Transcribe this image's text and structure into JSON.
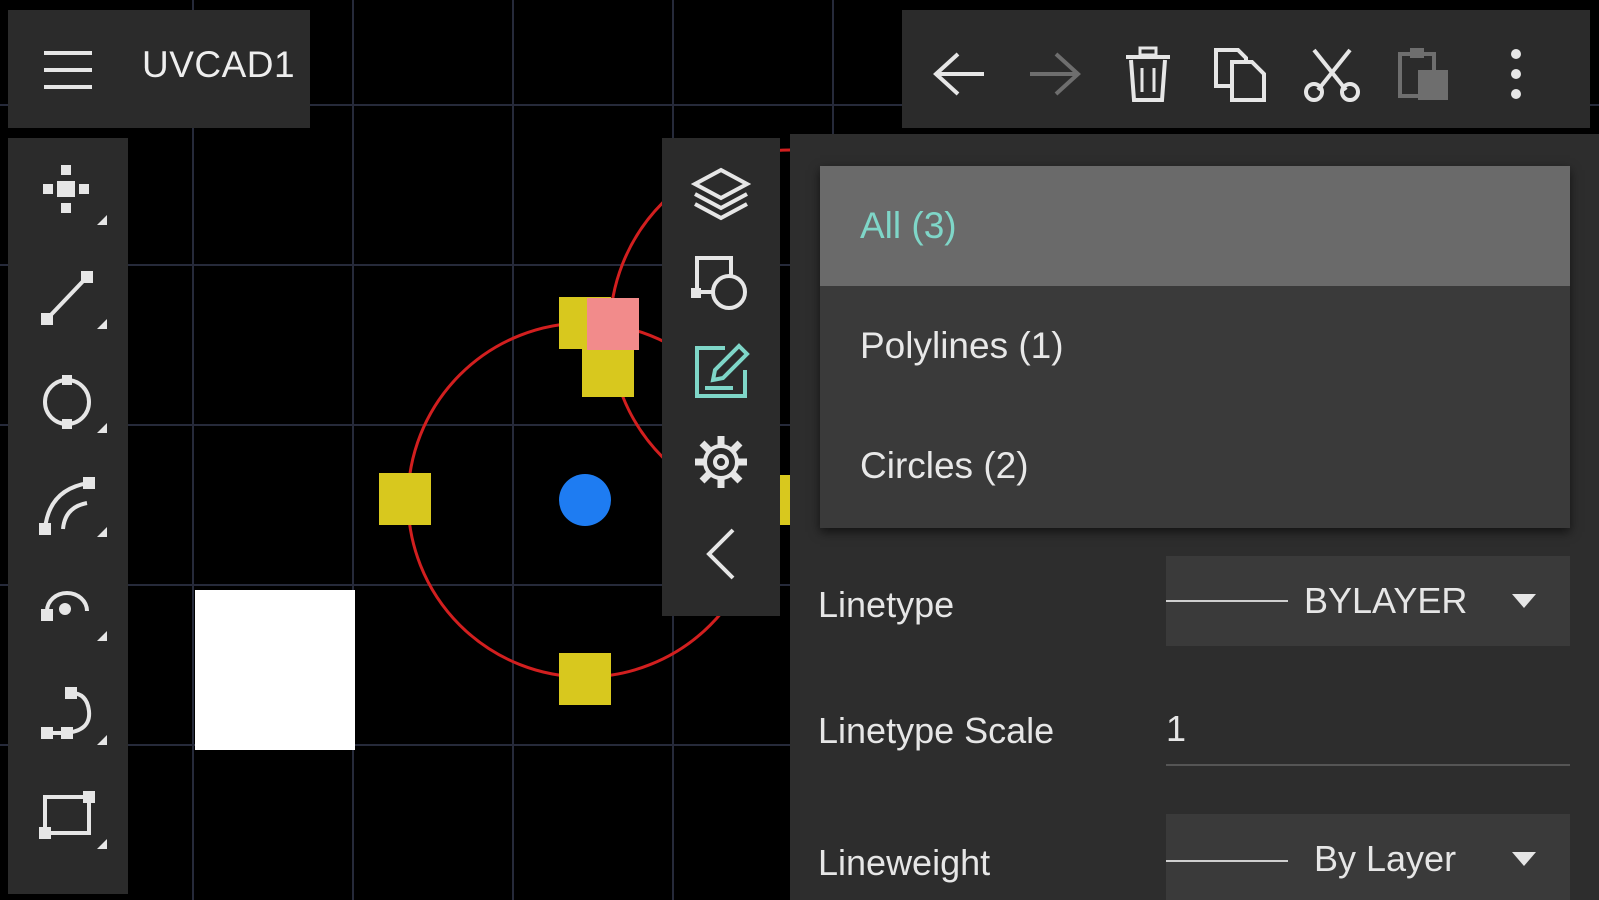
{
  "app": {
    "document_title": "UVCAD1"
  },
  "toolbar": {
    "items": [
      "menu-icon",
      "undo-icon",
      "redo-icon",
      "delete-icon",
      "copy-icon",
      "cut-icon",
      "paste-icon",
      "more-icon"
    ]
  },
  "left_tools": [
    "move-icon",
    "line-icon",
    "circle-icon",
    "arc-icon",
    "rotate-icon",
    "polyline-icon",
    "rectangle-icon"
  ],
  "mid_tools": [
    "layers-icon",
    "shapes-icon",
    "edit-icon",
    "settings-icon",
    "collapse-left-icon"
  ],
  "filter_dropdown": {
    "items": [
      "All (3)",
      "Polylines (1)",
      "Circles (2)"
    ],
    "selected_index": 0
  },
  "properties": {
    "linetype": {
      "label": "Linetype",
      "value": "BYLAYER"
    },
    "linetype_scale": {
      "label": "Linetype Scale",
      "value": "1"
    },
    "lineweight": {
      "label": "Lineweight",
      "value": "By Layer"
    }
  },
  "colors": {
    "accent_text": "#7fd6c8",
    "circle_stroke": "#d21f1f",
    "grip": "#d8c81e",
    "grip_hot": "#f28b8b",
    "center_point": "#1e7cf2",
    "grid": "#2a2a3a"
  }
}
